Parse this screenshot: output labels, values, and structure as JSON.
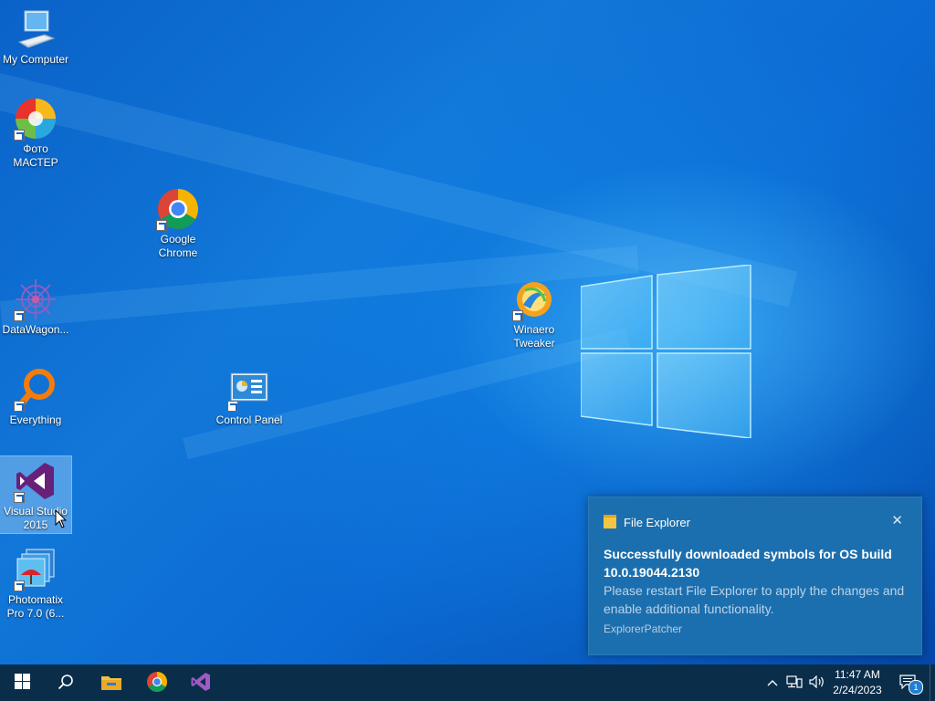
{
  "desktop": {
    "icons": [
      {
        "id": "my-computer",
        "label": "My Computer",
        "icon": "monitor-icon"
      },
      {
        "id": "foto-master",
        "label": "Фото\nМАСТЕР",
        "icon": "color-ball-icon"
      },
      {
        "id": "google-chrome",
        "label": "Google\nChrome",
        "icon": "chrome-icon"
      },
      {
        "id": "datawagon",
        "label": "DataWagon...",
        "icon": "gear-flower-icon"
      },
      {
        "id": "winaero-tweaker",
        "label": "Winaero\nTweaker",
        "icon": "winaero-icon"
      },
      {
        "id": "everything",
        "label": "Everything",
        "icon": "magnifier-icon"
      },
      {
        "id": "control-panel",
        "label": "Control Panel",
        "icon": "control-panel-icon"
      },
      {
        "id": "visual-studio",
        "label": "Visual Studio\n2015",
        "icon": "visual-studio-icon",
        "selected": true
      },
      {
        "id": "photomatix",
        "label": "Photomatix\nPro 7.0 (6...",
        "icon": "photomatix-icon"
      }
    ]
  },
  "notification": {
    "app": "File Explorer",
    "title": "Successfully downloaded symbols for OS build 10.0.19044.2130",
    "body": "Please restart File Explorer to apply the changes and enable additional functionality.",
    "attribution": "ExplorerPatcher",
    "close_glyph": "✕"
  },
  "taskbar": {
    "pinned": [
      "start-icon",
      "search-icon",
      "file-explorer-icon",
      "chrome-icon",
      "visual-studio-icon"
    ],
    "tray": [
      "chevron-up-icon",
      "network-icon",
      "volume-icon"
    ],
    "time": "11:47 AM",
    "date": "2/24/2023",
    "notification_count": "1"
  },
  "colors": {
    "taskbar": "#0a2d4a",
    "toast": "#1c6fae",
    "accent": "#0a62c9"
  }
}
